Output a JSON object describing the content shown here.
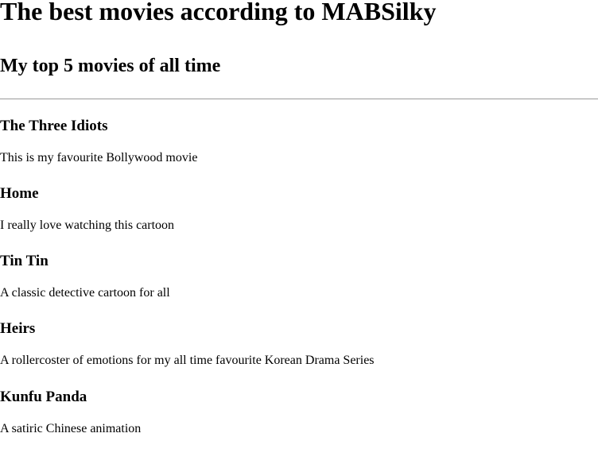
{
  "header": {
    "title": "The best movies according to MABSilky",
    "subtitle": "My top 5 movies of all time"
  },
  "movies": [
    {
      "title": "The Three Idiots",
      "description": "This is my favourite Bollywood movie"
    },
    {
      "title": "Home",
      "description": "I really love watching this cartoon"
    },
    {
      "title": "Tin Tin",
      "description": "A classic detective cartoon for all"
    },
    {
      "title": "Heirs",
      "description": "A rollercoster of emotions for my all time favourite Korean Drama Series"
    },
    {
      "title": "Kunfu Panda",
      "description": "A satiric Chinese animation"
    }
  ]
}
